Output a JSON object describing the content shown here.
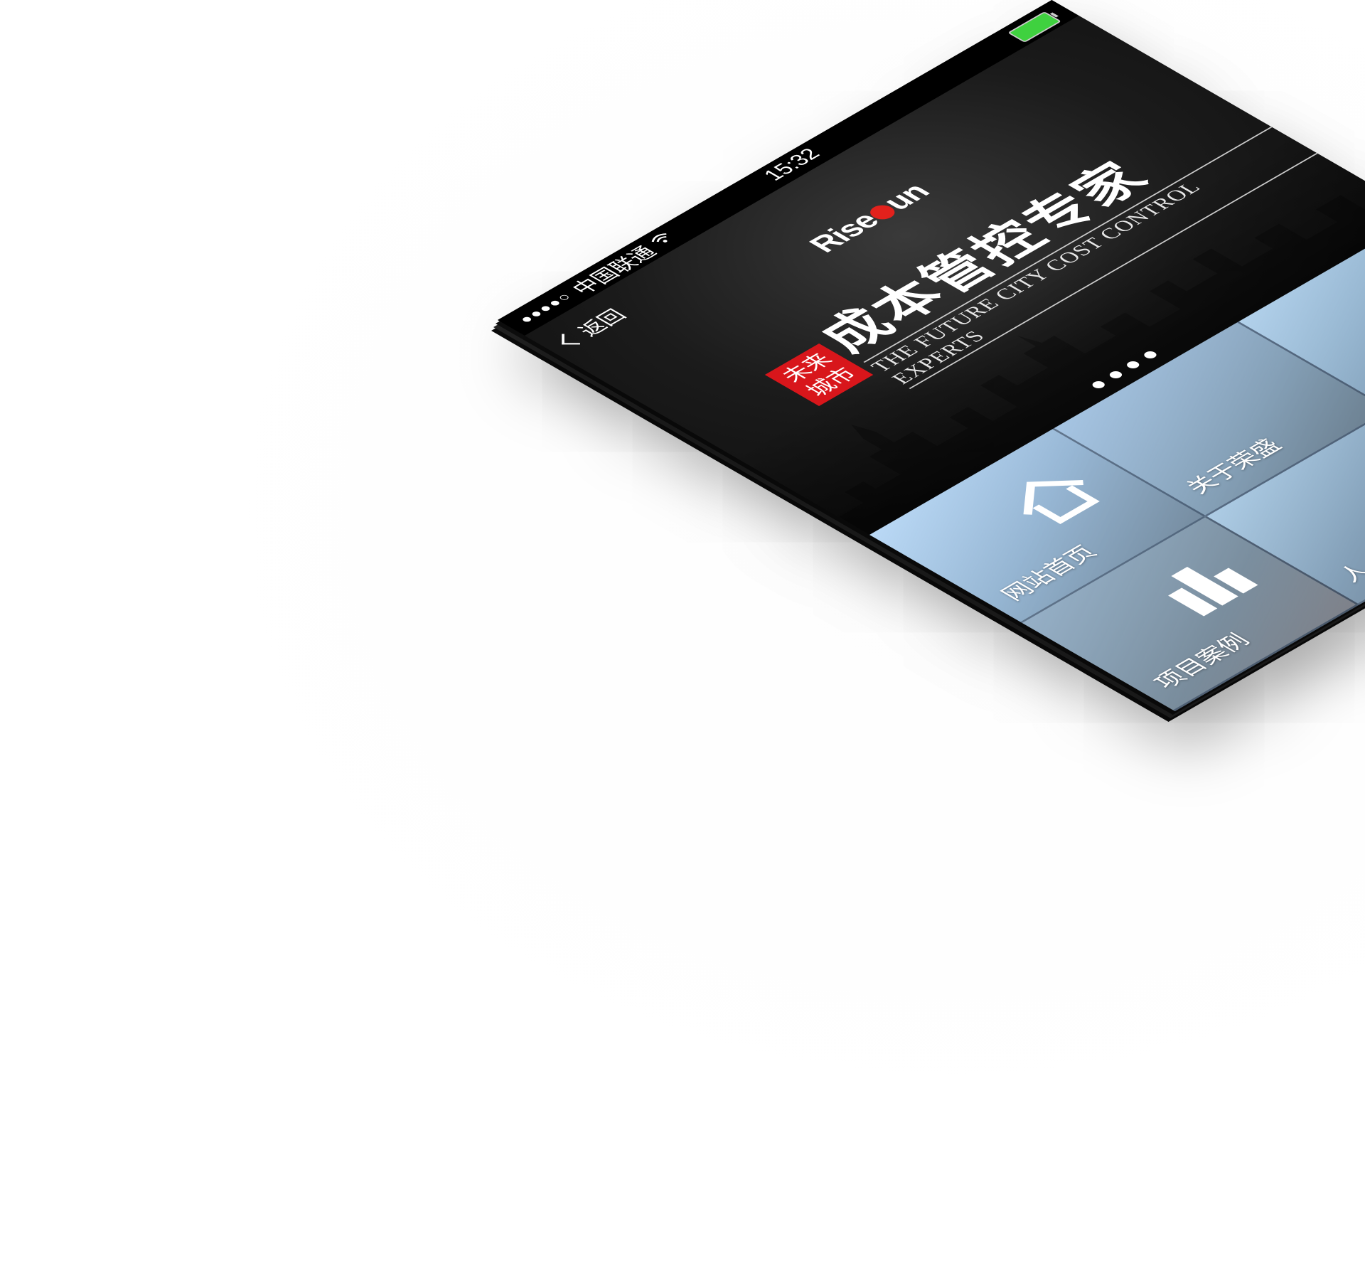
{
  "status_bar": {
    "signal": "●●●●○",
    "carrier": "中国联通",
    "wifi_icon": "wifi-icon",
    "time": "15:32",
    "battery_icon": "battery-icon",
    "battery_color": "#3fd13f"
  },
  "nav": {
    "back_label": "返回"
  },
  "banner": {
    "logo_prefix": "Rise",
    "logo_suffix": "un",
    "slogan_seal": "未来\n城市",
    "slogan_title": "成本管控专家",
    "slogan_subtitle": "THE FUTURE CITY COST CONTROL EXPERTS",
    "page_count": 4,
    "seal_color": "#d8161b"
  },
  "tiles": [
    {
      "label": "网站首页",
      "icon": "home-icon"
    },
    {
      "label": "关于荣盛",
      "icon": ""
    },
    {
      "label": "",
      "icon": ""
    },
    {
      "label": "项目案例",
      "icon": "buildings-icon"
    },
    {
      "label": "人",
      "icon": ""
    },
    {
      "label": "",
      "icon": ""
    }
  ]
}
